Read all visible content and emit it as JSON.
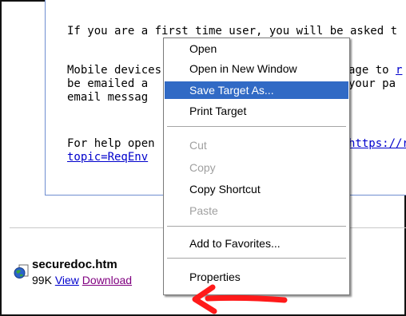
{
  "page": {
    "para1": "If you are a first time user, you will be asked t",
    "para2_line1": "Mobile devices",
    "para2_line1_tail": "age to ",
    "para2_line2": "be emailed a ",
    "para2_line2_tail": "your pa",
    "para2_line3": "email messag",
    "para3_line1": "For help open",
    "para3_line1_link": "https://r",
    "para3_line2_link": "topic=ReqEnv"
  },
  "attachment": {
    "icon": "globe-document-icon",
    "filename": "securedoc.htm",
    "size": "99K",
    "view": "View",
    "download": "Download"
  },
  "context_menu": {
    "items": [
      {
        "label": "Open",
        "state": "enabled"
      },
      {
        "label": "Open in New Window",
        "state": "enabled"
      },
      {
        "label": "Save Target As...",
        "state": "selected"
      },
      {
        "label": "Print Target",
        "state": "enabled"
      },
      {
        "label": "Cut",
        "state": "disabled"
      },
      {
        "label": "Copy",
        "state": "disabled"
      },
      {
        "label": "Copy Shortcut",
        "state": "enabled"
      },
      {
        "label": "Paste",
        "state": "disabled"
      },
      {
        "label": "Add to Favorites...",
        "state": "enabled"
      },
      {
        "label": "Properties",
        "state": "enabled"
      }
    ],
    "highlight_color": "#316ac5"
  },
  "annotation": {
    "icon": "red-arrow-icon",
    "color": "#ff0000"
  }
}
